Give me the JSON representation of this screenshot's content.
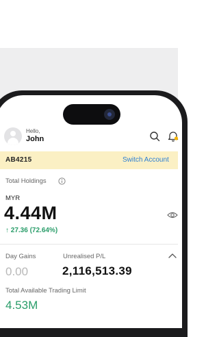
{
  "header": {
    "greeting": "Hello,",
    "user_name": "John",
    "icons": [
      "search-icon",
      "bell-icon"
    ],
    "notification_dot_color": "#f5b400"
  },
  "account": {
    "id": "AB4215",
    "switch_label": "Switch Account",
    "bar_color": "#fbf0c4",
    "link_color": "#2d7fd3"
  },
  "holdings": {
    "label": "Total Holdings",
    "currency": "MYR",
    "value": "4.44M",
    "change": "↑ 27.36 (72.64%)",
    "change_color": "#2a9d6a"
  },
  "stats": {
    "day_gains_label": "Day Gains",
    "day_gains_value": "0.00",
    "unrealised_label": "Unrealised P/L",
    "unrealised_value": "2,116,513.39",
    "limit_label": "Total Available Trading Limit",
    "limit_value": "4.53M"
  }
}
